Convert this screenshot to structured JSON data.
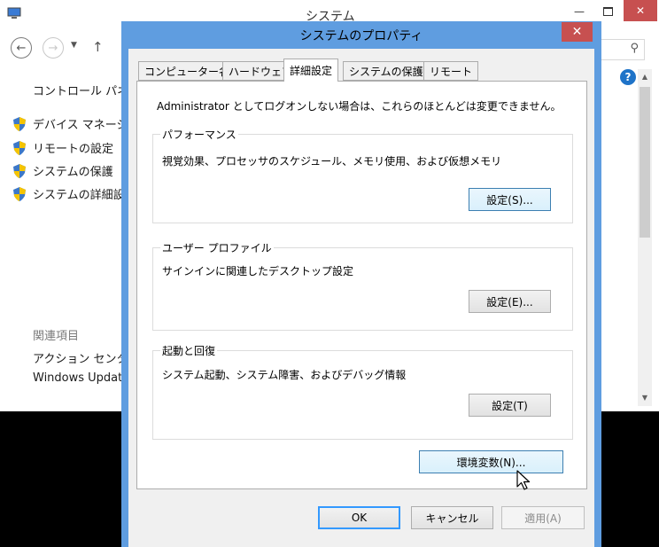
{
  "background_window": {
    "title": "システム",
    "breadcrumb_root": "コントロール パネル",
    "links": [
      "デバイス マネージャー",
      "リモートの設定",
      "システムの保護",
      "システムの詳細設定"
    ],
    "related_heading": "関連項目",
    "related_links": [
      "アクション センター",
      "Windows Update"
    ]
  },
  "dialog": {
    "title": "システムのプロパティ",
    "tabs": [
      "コンピューター名",
      "ハードウェア",
      "詳細設定",
      "システムの保護",
      "リモート"
    ],
    "active_tab": "詳細設定",
    "admin_note": "Administrator としてログオンしない場合は、これらのほとんどは変更できません。",
    "performance": {
      "label": "パフォーマンス",
      "description": "視覚効果、プロセッサのスケジュール、メモリ使用、および仮想メモリ",
      "button": "設定(S)..."
    },
    "user_profiles": {
      "label": "ユーザー プロファイル",
      "description": "サインインに関連したデスクトップ設定",
      "button": "設定(E)..."
    },
    "startup_recovery": {
      "label": "起動と回復",
      "description": "システム起動、システム障害、およびデバッグ情報",
      "button": "設定(T)"
    },
    "env_button": "環境変数(N)...",
    "ok_button": "OK",
    "cancel_button": "キャンセル",
    "apply_button": "適用(A)"
  },
  "colors": {
    "titlebar_active": "#5f9de0",
    "close_red": "#c75050",
    "dialog_face": "#f0f0f0"
  }
}
